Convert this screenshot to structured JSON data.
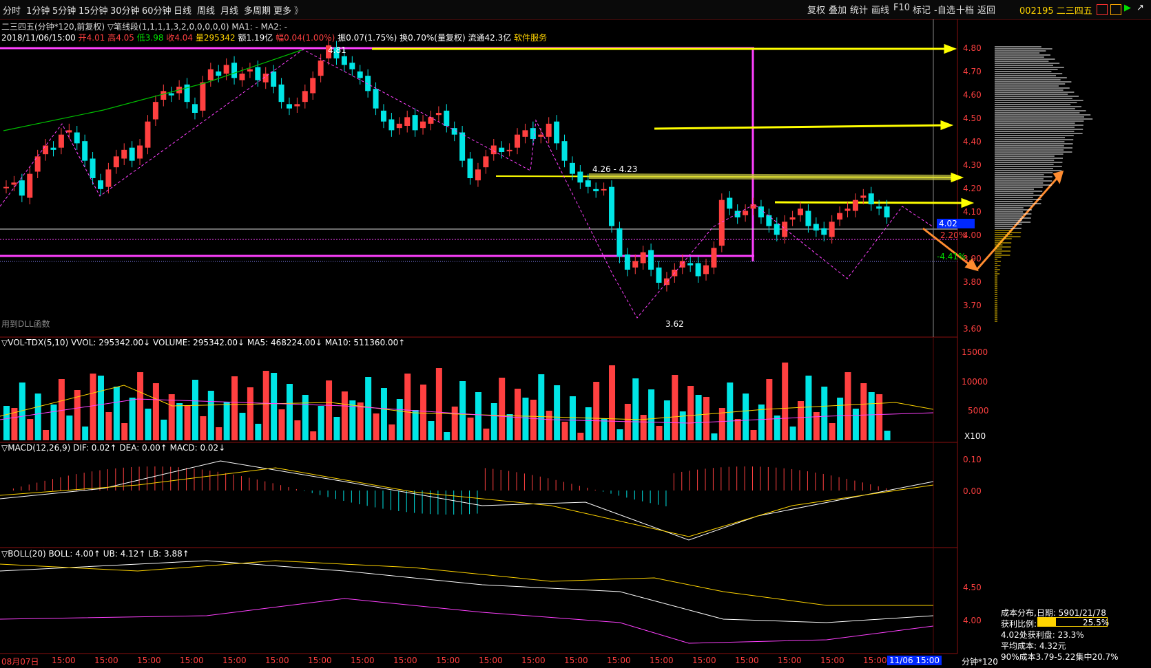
{
  "toolbar": {
    "periods": [
      "分时",
      "1分钟",
      "5分钟",
      "15分钟",
      "30分钟",
      "60分钟",
      "日线",
      "周线",
      "月线",
      "多周期",
      "更多"
    ],
    "buttons": [
      "复权",
      "叠加",
      "统计",
      "画线",
      "F10",
      "标记",
      "-自选",
      "十档",
      "返回"
    ],
    "stock": "002195 二三四五"
  },
  "header": {
    "line1": "二三四五(分钟*120,前复权) ▽笔线段(1,1,1,1,3,2,0,0,0,0,0)  MA1: -  MA2: -",
    "date": "2018/11/06/15:00",
    "open": "开4.01",
    "high": "高4.05",
    "low": "低3.98",
    "close": "收4.04",
    "vol": "量295342",
    "amount": "额1.19亿",
    "change": "幅0.04(1.00%)",
    "amplitude": "振0.07(1.75%)",
    "turnover": "换0.70%(量复权)",
    "float": "流通42.3亿",
    "industry": "软件服务"
  },
  "annotations": {
    "high_label": "4.81",
    "low_label": "3.62",
    "range_label": "4.26 - 4.23",
    "current_price": "4.02",
    "pct_up": "2.20%",
    "pct_down": "-4.41%",
    "dll": "用到DLL函数"
  },
  "price_axis": [
    "4.80",
    "4.70",
    "4.60",
    "4.50",
    "4.40",
    "4.30",
    "4.20",
    "4.10",
    "4.00",
    "3.90",
    "3.80",
    "3.70",
    "3.60"
  ],
  "vol_panel": {
    "label": "▽VOL-TDX(5,10)  VVOL: 295342.00↓  VOLUME: 295342.00↓  MA5: 468224.00↓  MA10: 511360.00↑",
    "axis": [
      "15000",
      "10000",
      "5000"
    ],
    "unit": "X100"
  },
  "macd_panel": {
    "label": "▽MACD(12,26,9)  DIF: 0.02↑  DEA: 0.00↑  MACD: 0.02↓",
    "axis": [
      "0.10",
      "0.00"
    ]
  },
  "boll_panel": {
    "label": "▽BOLL(20)  BOLL: 4.00↑  UB: 4.12↑  LB: 3.88↑",
    "axis": [
      "4.50",
      "4.00"
    ]
  },
  "time_axis": {
    "first": "08月07日",
    "ticks": [
      "15:00",
      "15:00",
      "15:00",
      "15:00",
      "15:00",
      "15:00",
      "15:00",
      "15:00",
      "15:00",
      "15:00",
      "15:00",
      "15:00",
      "15:00",
      "15:00",
      "15:00",
      "15:00",
      "15:00",
      "15:00",
      "15:00",
      "15:00"
    ],
    "current": "11/06 15:00",
    "unit": "分钟*120"
  },
  "cost_info": {
    "title": "成本分布,日期: 5901/21/78",
    "profit_label": "获利比例:",
    "profit_pct": "25.5%",
    "profit_value": 0.255,
    "line3": "4.02处获利盘: 23.3%",
    "line4": "平均成本: 4.32元",
    "line5": "90%成本3.79-5.22集中20.7%"
  },
  "colors": {
    "up": "#ff4040",
    "down": "#00e5e5",
    "ma": "#ffd400",
    "ma10": "#ff40ff",
    "accent": "#ffff00"
  }
}
